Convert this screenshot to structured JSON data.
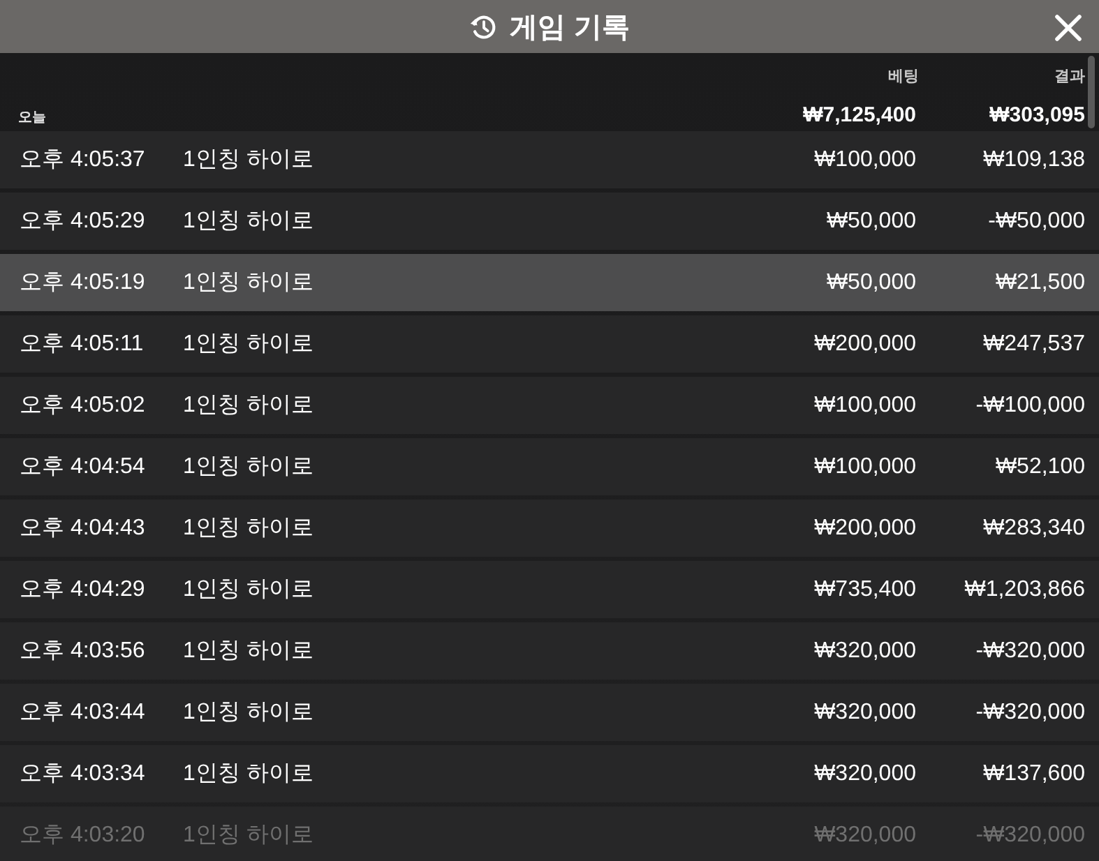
{
  "header": {
    "title": "게임 기록"
  },
  "columns": [
    "베팅",
    "결과"
  ],
  "summary": {
    "label": "오늘",
    "bet_total": "₩7,125,400",
    "result_total": "₩303,095"
  },
  "rows": [
    {
      "time": "오후 4:05:37",
      "game": "1인칭 하이로",
      "bet": "₩100,000",
      "result": "₩109,138",
      "selected": false
    },
    {
      "time": "오후 4:05:29",
      "game": "1인칭 하이로",
      "bet": "₩50,000",
      "result": "-₩50,000",
      "selected": false
    },
    {
      "time": "오후 4:05:19",
      "game": "1인칭 하이로",
      "bet": "₩50,000",
      "result": "₩21,500",
      "selected": true
    },
    {
      "time": "오후 4:05:11",
      "game": "1인칭 하이로",
      "bet": "₩200,000",
      "result": "₩247,537",
      "selected": false
    },
    {
      "time": "오후 4:05:02",
      "game": "1인칭 하이로",
      "bet": "₩100,000",
      "result": "-₩100,000",
      "selected": false
    },
    {
      "time": "오후 4:04:54",
      "game": "1인칭 하이로",
      "bet": "₩100,000",
      "result": "₩52,100",
      "selected": false
    },
    {
      "time": "오후 4:04:43",
      "game": "1인칭 하이로",
      "bet": "₩200,000",
      "result": "₩283,340",
      "selected": false
    },
    {
      "time": "오후 4:04:29",
      "game": "1인칭 하이로",
      "bet": "₩735,400",
      "result": "₩1,203,866",
      "selected": false
    },
    {
      "time": "오후 4:03:56",
      "game": "1인칭 하이로",
      "bet": "₩320,000",
      "result": "-₩320,000",
      "selected": false
    },
    {
      "time": "오후 4:03:44",
      "game": "1인칭 하이로",
      "bet": "₩320,000",
      "result": "-₩320,000",
      "selected": false
    },
    {
      "time": "오후 4:03:34",
      "game": "1인칭 하이로",
      "bet": "₩320,000",
      "result": "₩137,600",
      "selected": false
    },
    {
      "time": "오후 4:03:20",
      "game": "1인칭 하이로",
      "bet": "₩320,000",
      "result": "-₩320,000",
      "selected": false
    }
  ]
}
